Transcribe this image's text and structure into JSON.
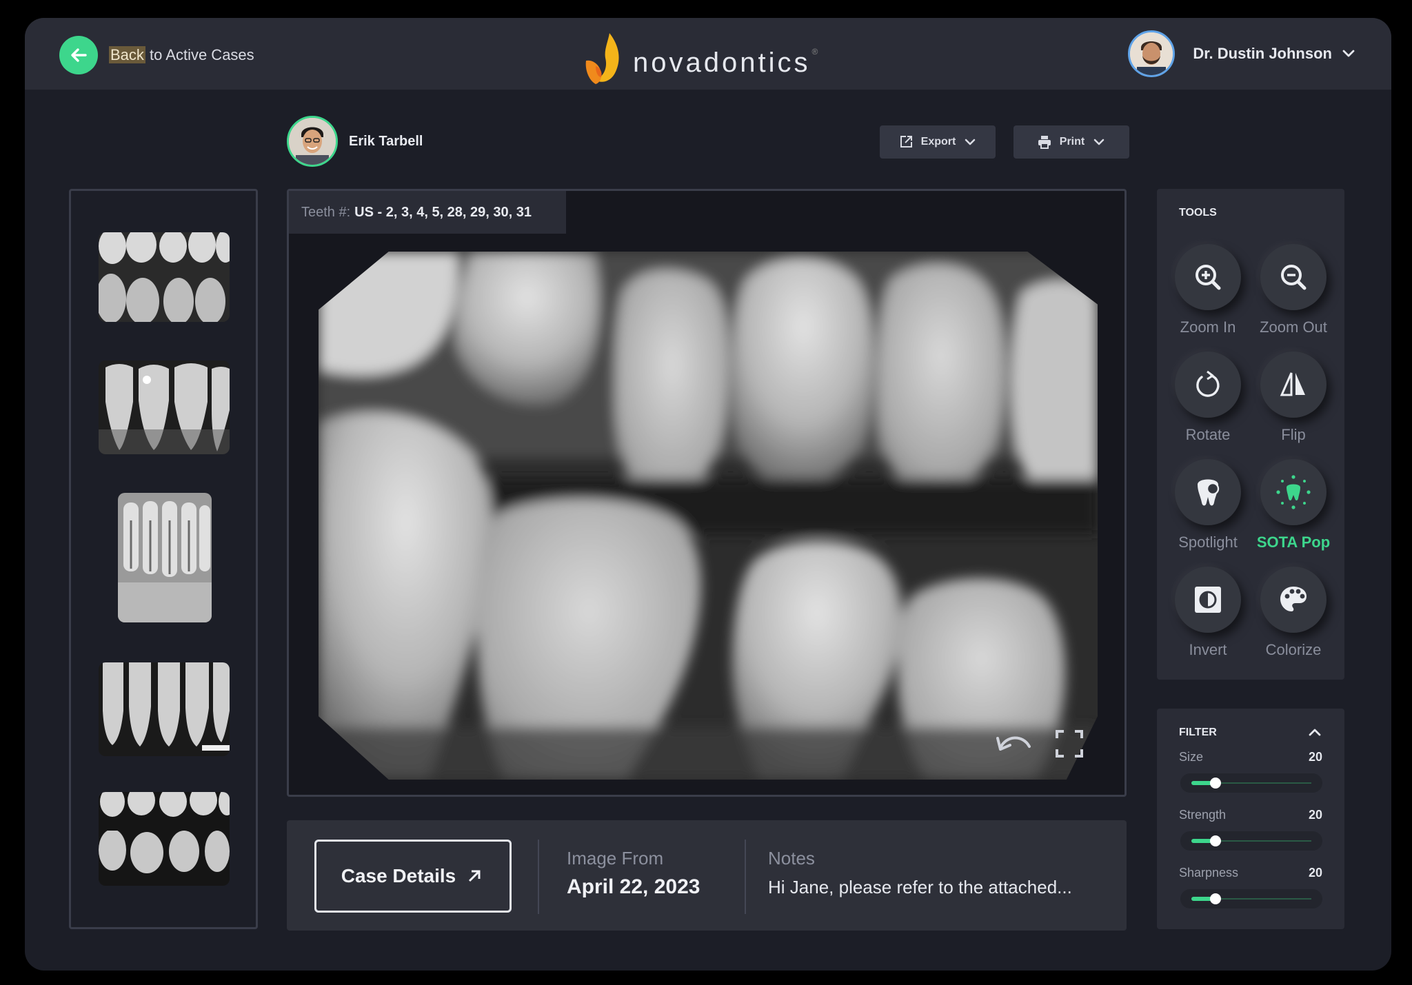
{
  "topbar": {
    "back_prefix": "Back",
    "back_suffix": " to Active Cases",
    "brand": "novadontics",
    "brand_mark": "®",
    "user_name": "Dr. Dustin Johnson"
  },
  "patient": {
    "name": "Erik Tarbell"
  },
  "actions": {
    "export_label": "Export",
    "print_label": "Print"
  },
  "viewer": {
    "teeth_label": "Teeth #:",
    "teeth_value": "US - 2, 3, 4, 5, 28, 29, 30, 31"
  },
  "details": {
    "case_details_label": "Case Details",
    "image_from_label": "Image From",
    "image_from_value": "April 22, 2023",
    "notes_label": "Notes",
    "notes_value": "Hi Jane, please refer to the attached..."
  },
  "tools": {
    "title": "TOOLS",
    "items": [
      {
        "label": "Zoom In",
        "icon": "zoom-in-icon"
      },
      {
        "label": "Zoom Out",
        "icon": "zoom-out-icon"
      },
      {
        "label": "Rotate",
        "icon": "rotate-icon"
      },
      {
        "label": "Flip",
        "icon": "flip-icon"
      },
      {
        "label": "Spotlight",
        "icon": "spotlight-icon"
      },
      {
        "label": "SOTA Pop",
        "icon": "sota-pop-icon",
        "active": true
      },
      {
        "label": "Invert",
        "icon": "invert-icon"
      },
      {
        "label": "Colorize",
        "icon": "palette-icon"
      }
    ]
  },
  "filter": {
    "title": "FILTER",
    "size_label": "Size",
    "size_value": "20",
    "strength_label": "Strength",
    "strength_value": "20",
    "sharpness_label": "Sharpness",
    "sharpness_value": "20",
    "level_fraction": 0.2
  },
  "colors": {
    "accent": "#3dd68c",
    "background": "#1c1e27",
    "panel": "#2a2c36"
  }
}
